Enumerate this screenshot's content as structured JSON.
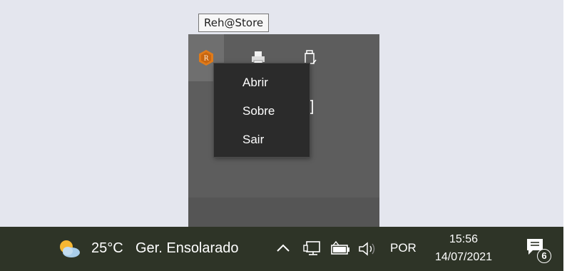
{
  "tooltip": {
    "text": "Reh@Store"
  },
  "flyout": {
    "icons": [
      {
        "name": "rehstore-app-icon",
        "color": "#e07b1a"
      },
      {
        "name": "printer-icon"
      },
      {
        "name": "usb-drive-icon"
      },
      {
        "name": "bracket-icon"
      }
    ]
  },
  "context_menu": {
    "items": [
      {
        "label": "Abrir"
      },
      {
        "label": "Sobre"
      },
      {
        "label": "Sair"
      }
    ]
  },
  "taskbar": {
    "weather": {
      "icon": "partly-sunny-icon",
      "temperature": "25°C",
      "condition": "Ger. Ensolarado"
    },
    "tray": {
      "chevron_icon": "chevron-up-icon",
      "network_icon": "network-monitor-icon",
      "battery_icon": "battery-icon",
      "volume_icon": "volume-icon",
      "language": "POR"
    },
    "clock": {
      "time": "15:56",
      "date": "14/07/2021"
    },
    "notifications": {
      "icon": "notification-center-icon",
      "count": "6"
    }
  },
  "colors": {
    "desktop": "#e4e6ee",
    "taskbar": "#2e3427",
    "flyout": "#5d5d5d",
    "menu": "#2b2b2b",
    "app_accent": "#e07b1a"
  }
}
